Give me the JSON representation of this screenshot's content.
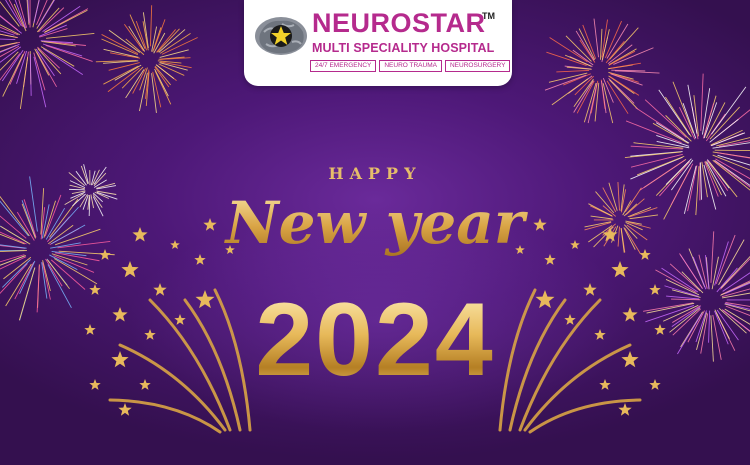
{
  "brand": {
    "name": "NEUROSTAR",
    "trademark": "TM",
    "subtitle": "MULTI SPECIALITY HOSPITAL",
    "tags": [
      "24/7 EMERGENCY",
      "NEURO TRAUMA",
      "NEUROSURGERY"
    ]
  },
  "greeting": {
    "happy": "HAPPY",
    "new_year": "New year",
    "year": "2024"
  },
  "colors": {
    "background": "#4d1877",
    "brand": "#b52a8d",
    "gold": "#e2b55c"
  },
  "icons": {
    "logo": "brain-star-logo",
    "decoration": "fireworks-stars"
  }
}
